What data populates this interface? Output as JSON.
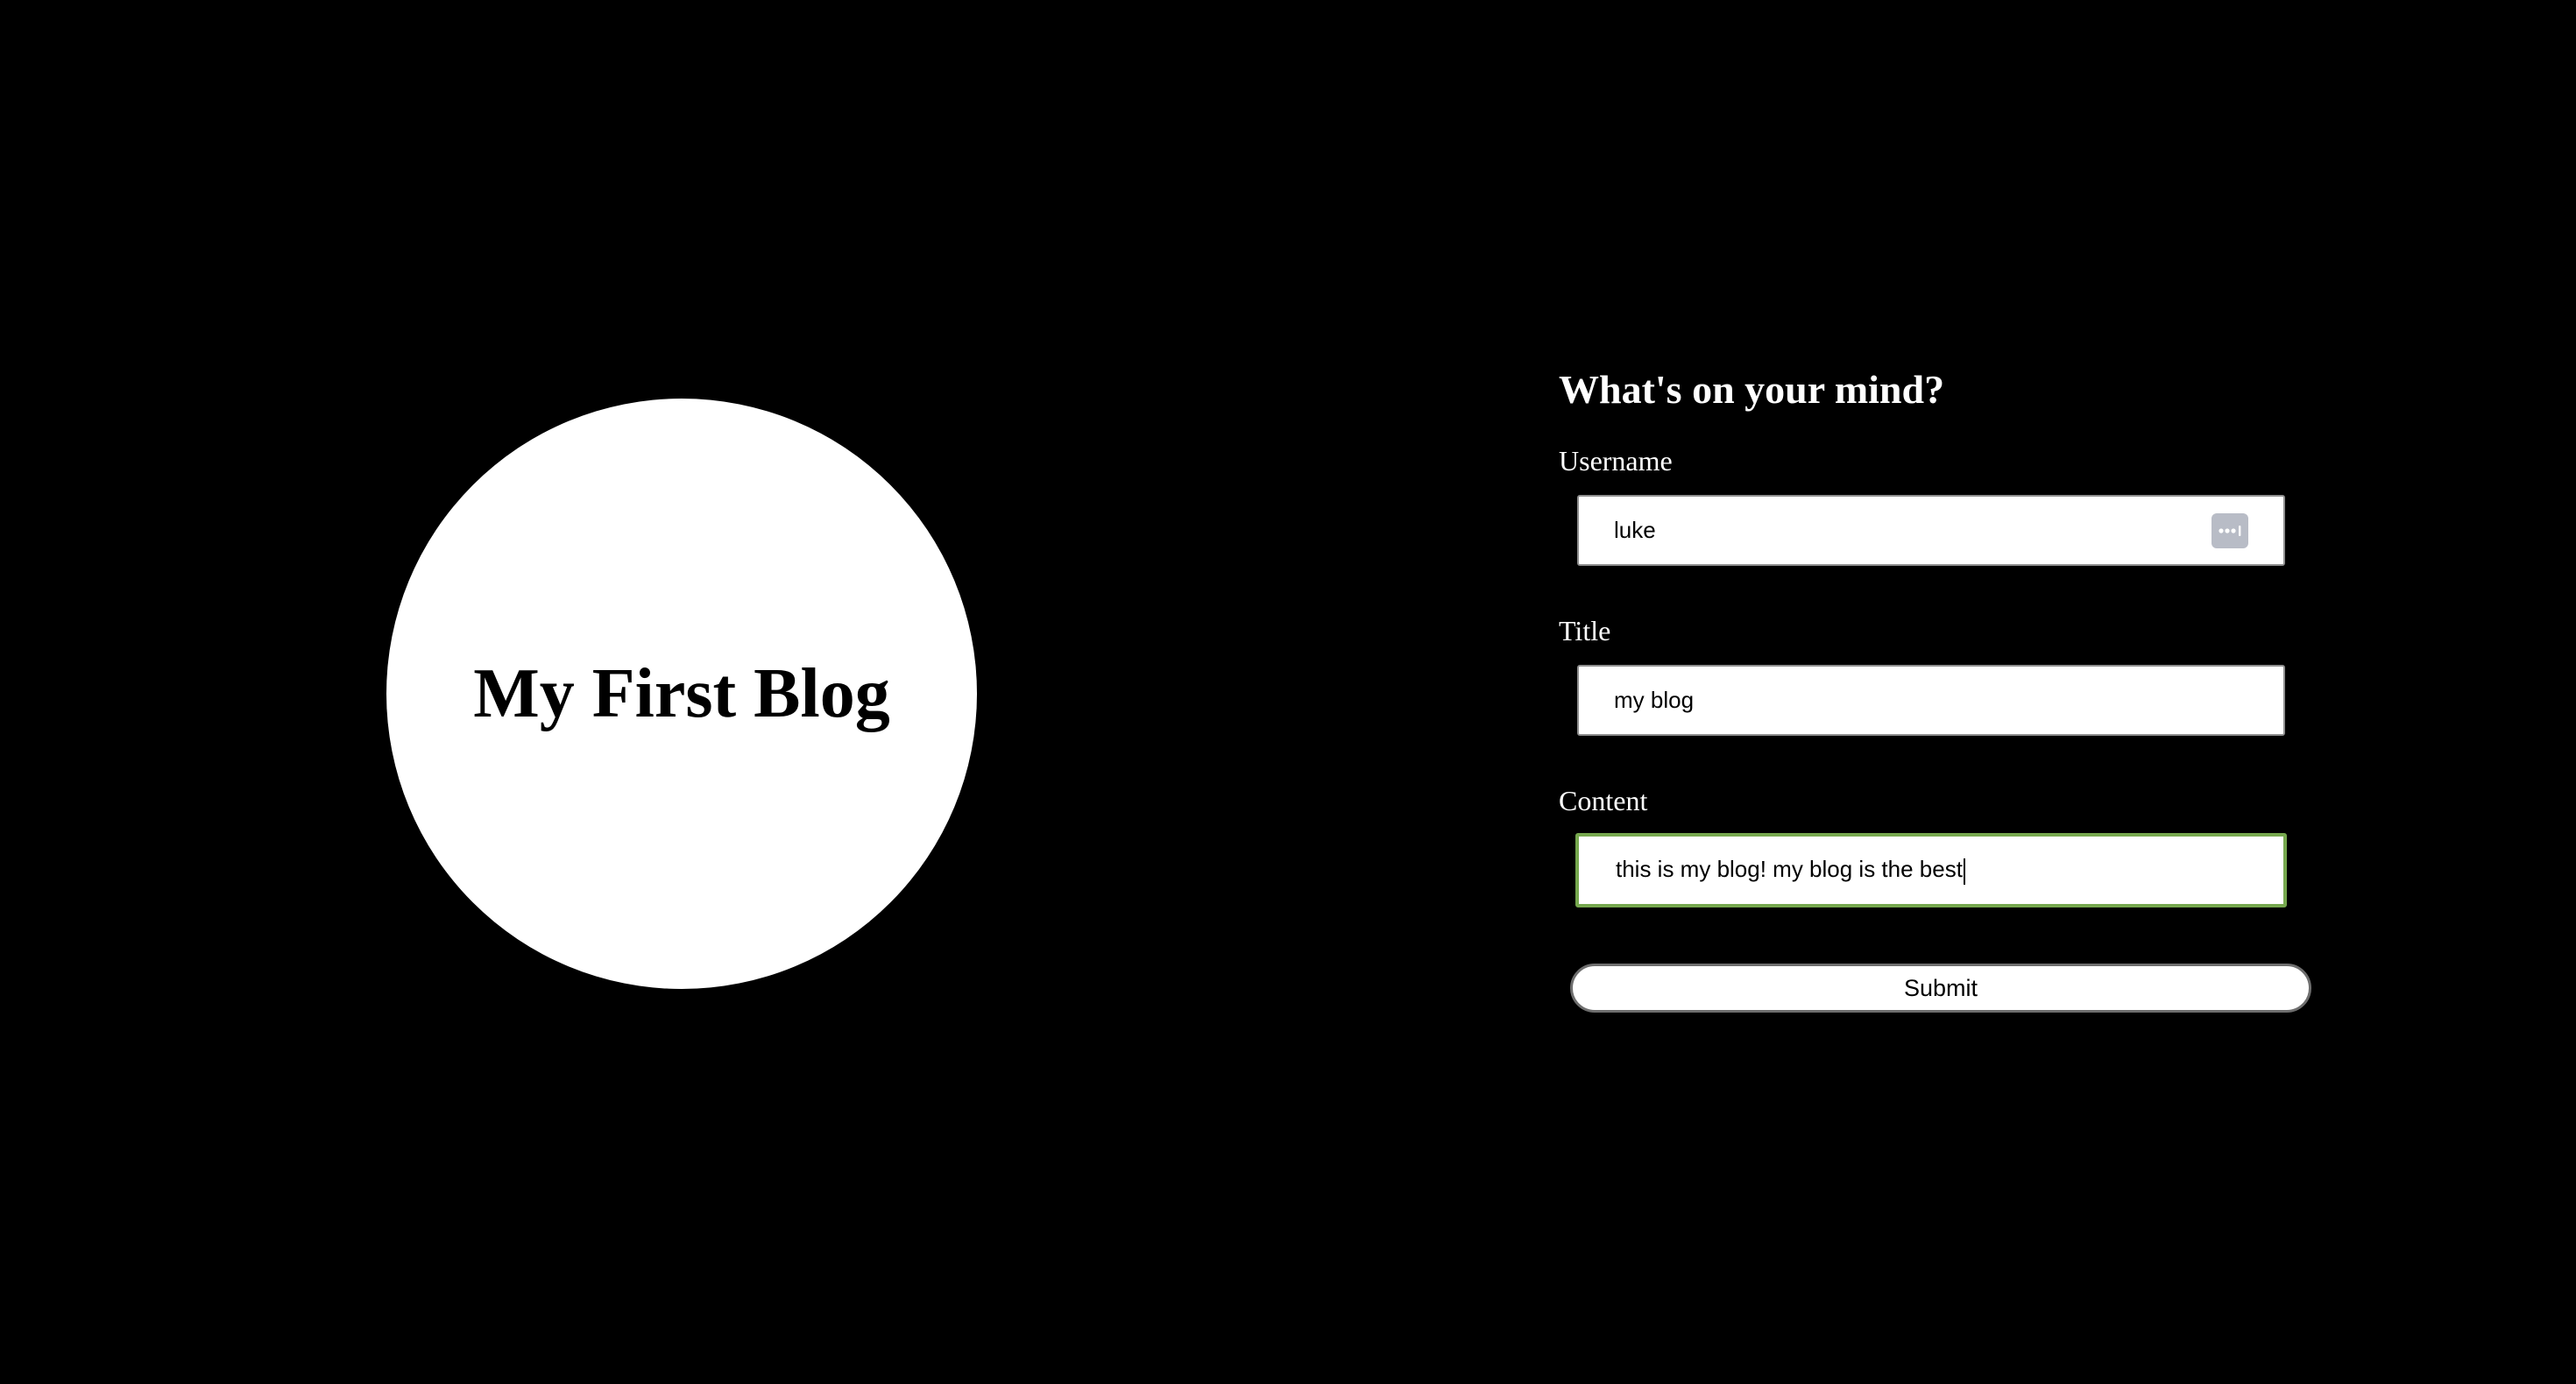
{
  "blog": {
    "title": "My First Blog"
  },
  "form": {
    "heading": "What's on your mind?",
    "username": {
      "label": "Username",
      "value": "luke",
      "autofill_icon": "password-key-icon"
    },
    "title": {
      "label": "Title",
      "value": "my blog"
    },
    "content": {
      "label": "Content",
      "value": "this is my blog! my blog is the best"
    },
    "submit_label": "Submit"
  },
  "colors": {
    "background": "#000000",
    "circle": "#ffffff",
    "focus_border": "#76a84e",
    "autofill_icon": "#b8bcc6"
  }
}
